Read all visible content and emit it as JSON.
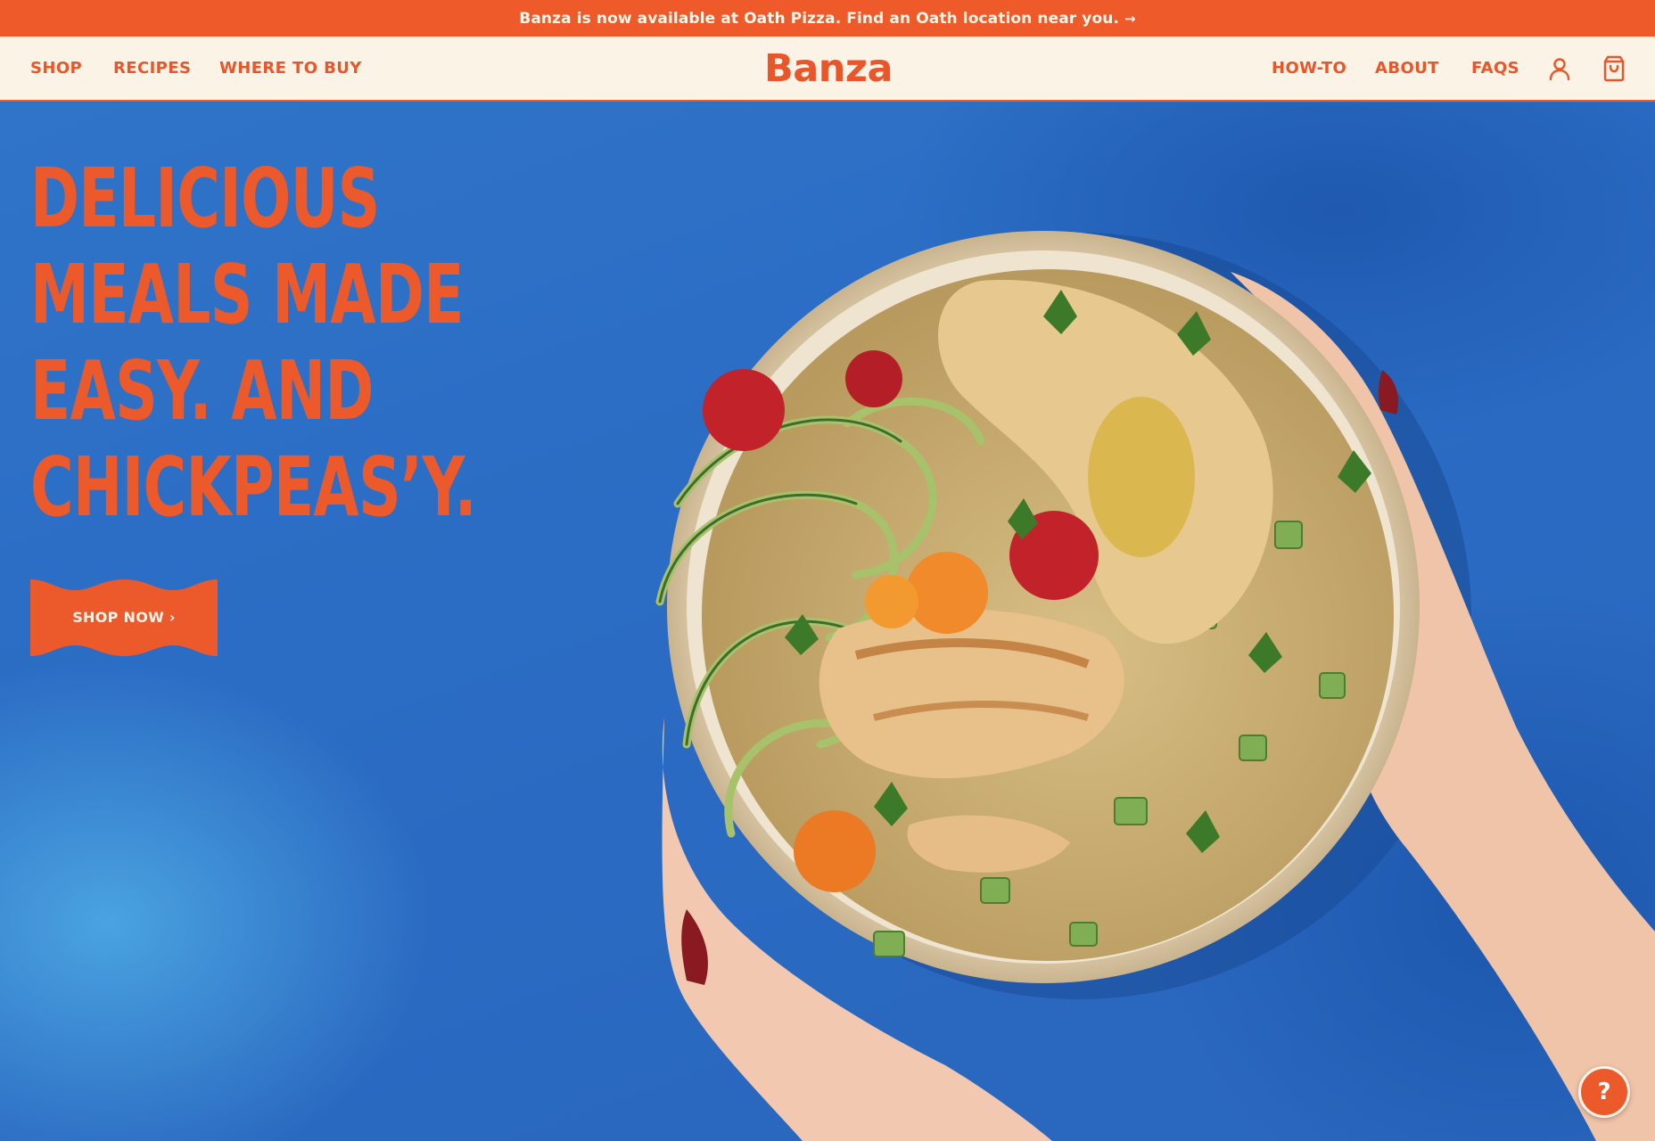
{
  "announcement": {
    "text": "Banza is now available at Oath Pizza. Find an Oath location near you.",
    "arrow": "→"
  },
  "nav": {
    "left_links": [
      "SHOP",
      "RECIPES",
      "WHERE TO BUY"
    ],
    "logo": "Banza",
    "right_links": [
      "HOW-TO",
      "ABOUT",
      "FAQS"
    ],
    "account_icon": "user-icon",
    "cart_icon": "shopping-bag-icon"
  },
  "hero": {
    "headline_lines": [
      "DELICIOUS",
      "MEALS MADE",
      "EASY. AND",
      "CHICKPEAS’Y."
    ],
    "cta_label": "SHOP NOW ›",
    "image_subject": "hands-holding-bowl-icon"
  },
  "help": {
    "label": "?"
  },
  "colors": {
    "brand_orange": "#ec5a2b",
    "cream": "#fbf3e6",
    "hero_blue": "#2b6cc4"
  }
}
